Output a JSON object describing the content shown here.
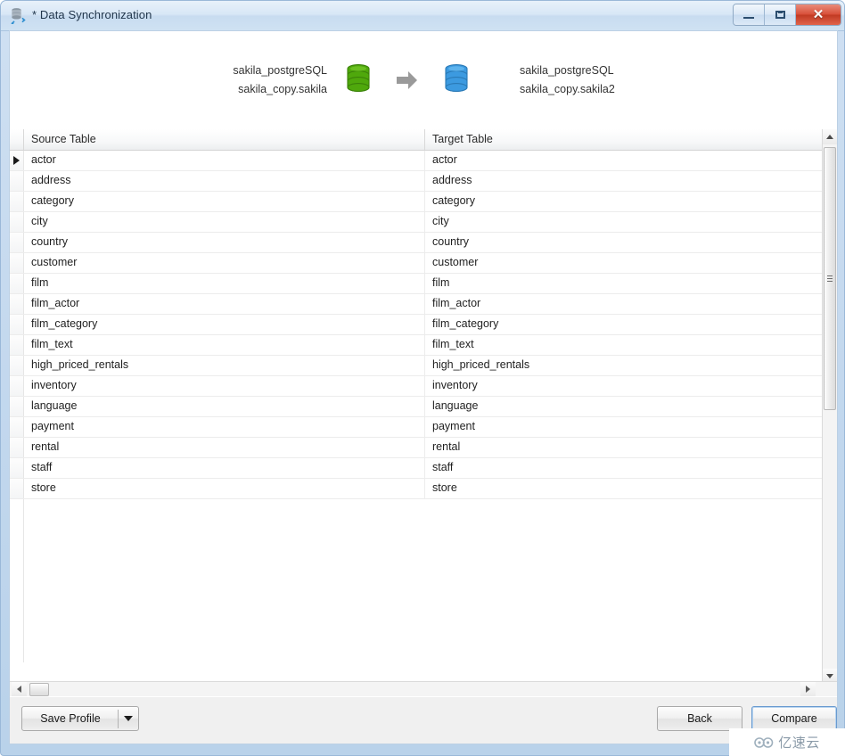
{
  "window": {
    "title": "* Data Synchronization",
    "title_icon": "data-sync-icon",
    "controls": {
      "minimize_label": "–",
      "maximize_label": "□",
      "close_label": "✕"
    }
  },
  "summary": {
    "source": {
      "connection": "sakila_postgreSQL",
      "schema": "sakila_copy.sakila",
      "icon": "database-icon-green",
      "color": "#4fa80c"
    },
    "direction_icon": "arrow-right-icon",
    "direction_color": "#999999",
    "target": {
      "connection": "sakila_postgreSQL",
      "schema": "sakila_copy.sakila2",
      "icon": "database-icon-blue",
      "color": "#3c9ae0"
    }
  },
  "grid": {
    "columns": [
      "Source Table",
      "Target Table"
    ],
    "selected_row_index": 0,
    "rows": [
      {
        "source": "actor",
        "target": "actor"
      },
      {
        "source": "address",
        "target": "address"
      },
      {
        "source": "category",
        "target": "category"
      },
      {
        "source": "city",
        "target": "city"
      },
      {
        "source": "country",
        "target": "country"
      },
      {
        "source": "customer",
        "target": "customer"
      },
      {
        "source": "film",
        "target": "film"
      },
      {
        "source": "film_actor",
        "target": "film_actor"
      },
      {
        "source": "film_category",
        "target": "film_category"
      },
      {
        "source": "film_text",
        "target": "film_text"
      },
      {
        "source": "high_priced_rentals",
        "target": "high_priced_rentals"
      },
      {
        "source": "inventory",
        "target": "inventory"
      },
      {
        "source": "language",
        "target": "language"
      },
      {
        "source": "payment",
        "target": "payment"
      },
      {
        "source": "rental",
        "target": "rental"
      },
      {
        "source": "staff",
        "target": "staff"
      },
      {
        "source": "store",
        "target": "store"
      }
    ]
  },
  "scrollbars": {
    "vertical": {
      "up_icon": "chevron-up-icon",
      "down_icon": "chevron-down-icon",
      "grip_icon": "grip-lines-icon"
    },
    "horizontal": {
      "left_icon": "chevron-left-icon",
      "right_icon": "chevron-right-icon"
    }
  },
  "buttons": {
    "save_profile": "Save Profile",
    "save_profile_dropdown_icon": "caret-down-icon",
    "back": "Back",
    "compare": "Compare"
  },
  "watermark": {
    "text": "亿速云",
    "logo_icon": "cloud-logo-icon"
  }
}
